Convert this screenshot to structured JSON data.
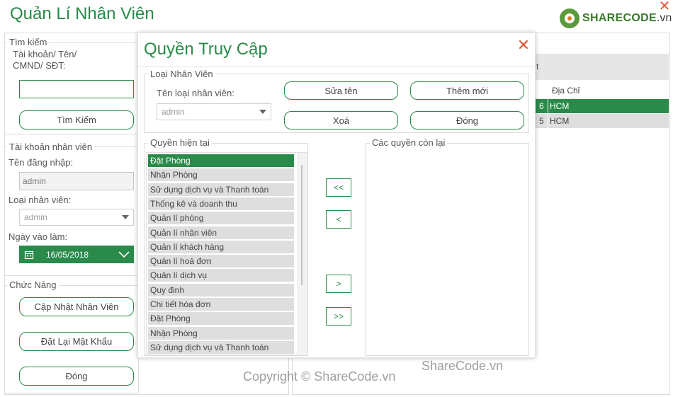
{
  "window": {
    "title": "Quản Lí Nhân Viên",
    "close_glyph": "✕",
    "logo": {
      "brand": "SHARECODE",
      "suffix": ".vn"
    }
  },
  "search": {
    "legend": "Tìm kiếm",
    "label": "Tài khoản/ Tên/ CMND/ SĐT:",
    "value": "",
    "button": "Tìm Kiếm"
  },
  "account": {
    "legend": "Tài khoản nhân viên",
    "username_label": "Tên đăng nhập:",
    "username_value": "admin",
    "type_label": "Loại nhân viên:",
    "type_value": "admin",
    "date_label": "Ngày vào làm:",
    "date_value": "16/05/2018"
  },
  "functions": {
    "legend": "Chức Năng",
    "update": "Cập Nhật Nhân Viên",
    "reset_password": "Đặt Lại Mật Khẩu",
    "close": "Đóng"
  },
  "grid": {
    "header_partial": "t",
    "address_header": "Địa Chỉ",
    "rows": [
      {
        "id_tail": "6",
        "address": "HCM",
        "selected": true
      },
      {
        "id_tail": "5",
        "address": "HCM",
        "selected": false
      }
    ]
  },
  "dialog": {
    "title": "Quyền Truy Cập",
    "close_glyph": "✕",
    "employee_type": {
      "legend": "Loại Nhân Viên",
      "label": "Tên loại nhân viên:",
      "value": "admin",
      "edit": "Sửa tên",
      "add": "Thêm mới",
      "delete": "Xoá",
      "close": "Đóng"
    },
    "current": {
      "legend": "Quyền hiện tại",
      "items": [
        "Đặt Phòng",
        "Nhận Phòng",
        "Sử dụng dịch vụ và Thanh toán",
        "Thống kê và doanh thu",
        "Quản lí phòng",
        "Quản lí nhân viên",
        "Quản lí khách hàng",
        "Quản lí hoá đơn",
        "Quản lí dịch vụ",
        "Quy định",
        "Chi tiết hóa đơn",
        "Đặt Phòng",
        "Nhận Phòng",
        "Sử dụng dịch vụ và Thanh toán"
      ]
    },
    "remaining": {
      "legend": "Các quyền còn lại"
    },
    "move": {
      "all_left": "<<",
      "one_left": "<",
      "one_right": ">",
      "all_right": ">>"
    }
  },
  "watermarks": {
    "center": "Copyright © ShareCode.vn",
    "right": "ShareCode.vn"
  }
}
